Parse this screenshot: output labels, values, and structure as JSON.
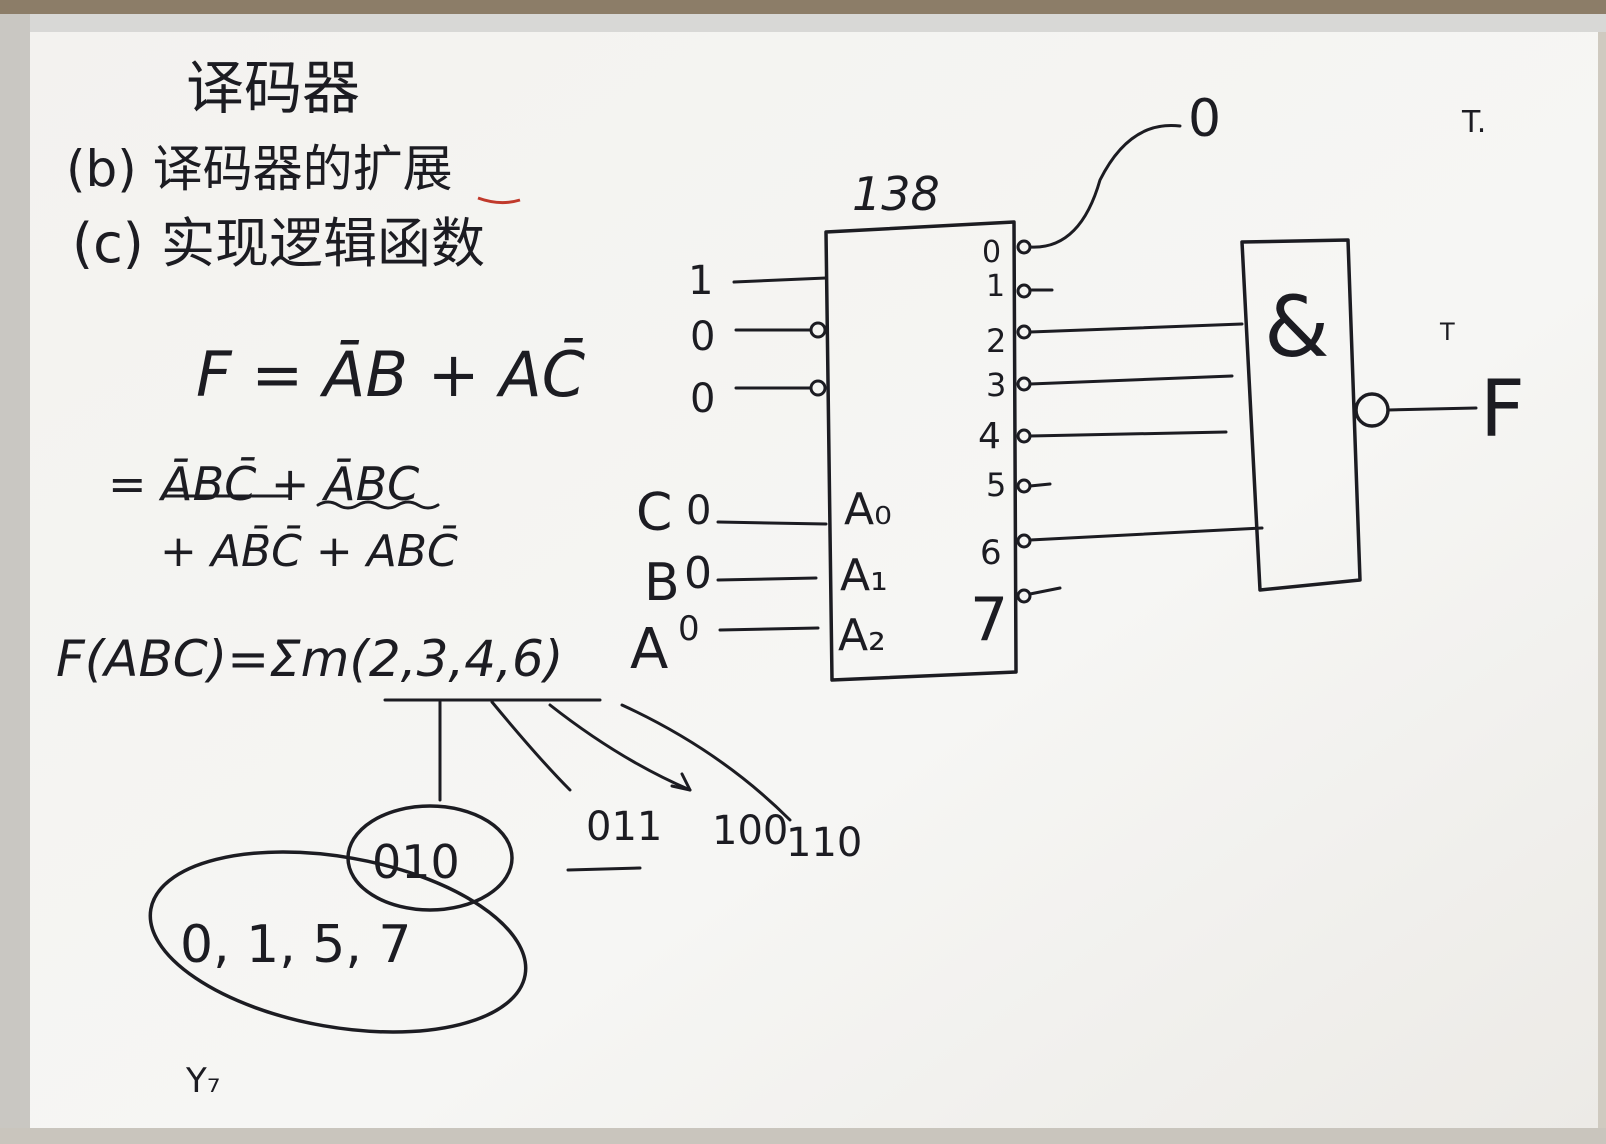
{
  "board": {
    "title": "译码器",
    "item_b": "(b) 译码器的扩展",
    "item_c": "(c) 实现逻辑函数",
    "formula_line1": "F = ĀB + AC̄",
    "formula_line2": "= ĀBC̄ + ĀBC",
    "formula_line3": "+ AB̄C̄ + ABC̄",
    "sum_of_minterms": "F(ABC)=Σm(2,3,4,6)",
    "binary_010": "010",
    "binary_011": "011",
    "binary_100": "100",
    "binary_110": "110",
    "unused_outputs": "0, 1, 5, 7",
    "bottom_mark": "Y₇",
    "corner_mark": "T.",
    "right_mark": "T"
  },
  "decoder": {
    "chip_label": "138",
    "enable_inputs": [
      "1",
      "0",
      "0"
    ],
    "address_pins": [
      "A₀",
      "A₁",
      "A₂"
    ],
    "variable_labels": [
      "C",
      "B",
      "A"
    ],
    "variable_values": [
      "0",
      "0",
      "0"
    ],
    "output_numbers": [
      "0",
      "1",
      "2",
      "3",
      "4",
      "5",
      "6",
      "7"
    ],
    "output0_value": "0"
  },
  "gate": {
    "symbol": "&",
    "output_label": "F"
  }
}
